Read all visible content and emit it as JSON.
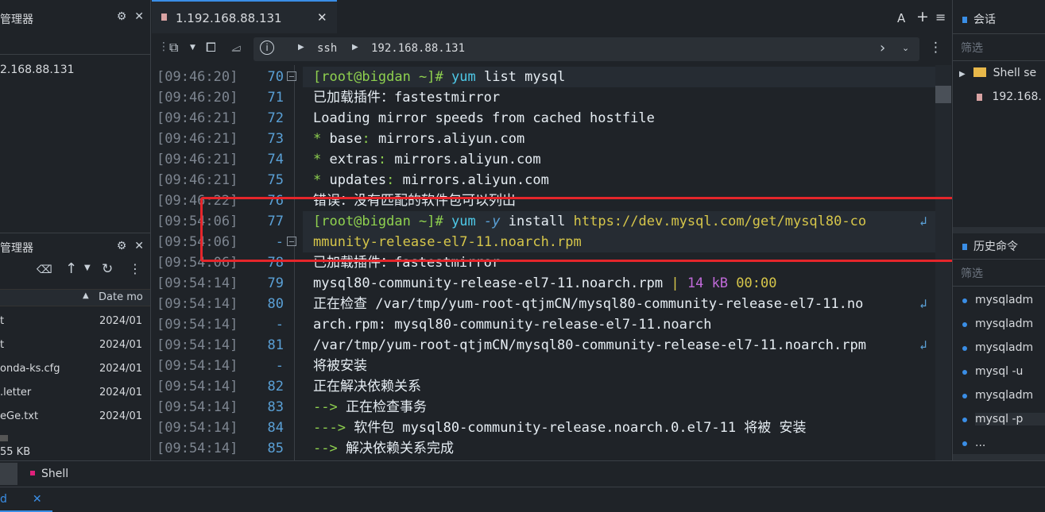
{
  "left": {
    "session_manager_title": "管理器",
    "session_host": "2.168.88.131",
    "file_manager_title": "管理器",
    "file_columns": [
      "Date mo"
    ],
    "files": [
      {
        "name": "t",
        "date": "2024/01"
      },
      {
        "name": "t",
        "date": "2024/01"
      },
      {
        "name": "onda-ks.cfg",
        "date": "2024/01"
      },
      {
        "name": ".letter",
        "date": "2024/01"
      },
      {
        "name": "eGe.txt",
        "date": "2024/01"
      }
    ],
    "file_status": "55 KB"
  },
  "tab": {
    "label": "1.192.168.88.131"
  },
  "tab_actions": {
    "font": "A",
    "add": "+",
    "menu": "≡"
  },
  "address": {
    "info": "i",
    "protocol": "ssh",
    "host": "192.168.88.131"
  },
  "terminal": {
    "lines": [
      {
        "ts": "[09:46:20]",
        "ln": "70",
        "fold": true,
        "type": "prompt",
        "prompt": "[root@bigdan ~]#",
        "cmd": "yum",
        "rest": " list mysql"
      },
      {
        "ts": "[09:46:20]",
        "ln": "71",
        "type": "text",
        "text": "已加载插件：fastestmirror"
      },
      {
        "ts": "[09:46:21]",
        "ln": "72",
        "type": "text",
        "text": "Loading mirror speeds from cached hostfile"
      },
      {
        "ts": "[09:46:21]",
        "ln": "73",
        "type": "kv",
        "key": "base",
        "val": "mirrors.aliyun.com"
      },
      {
        "ts": "[09:46:21]",
        "ln": "74",
        "type": "kv",
        "key": "extras",
        "val": "mirrors.aliyun.com"
      },
      {
        "ts": "[09:46:21]",
        "ln": "75",
        "type": "kv",
        "key": "updates",
        "val": "mirrors.aliyun.com"
      },
      {
        "ts": "[09:46:22]",
        "ln": "76",
        "type": "text",
        "text": "错误：没有匹配的软件包可以列出"
      },
      {
        "ts": "[09:54:06]",
        "ln": "77",
        "type": "install",
        "prompt": "[root@bigdan ~]#",
        "cmd": "yum",
        "flag": "-y",
        "word": "install",
        "url": "https://dev.mysql.com/get/mysql80-co",
        "wrap": true
      },
      {
        "ts": "[09:54:06]",
        "ln": "-",
        "fold": true,
        "type": "url",
        "url": "mmunity-release-el7-11.noarch.rpm"
      },
      {
        "ts": "[09:54:06]",
        "ln": "78",
        "type": "text",
        "text": "已加载插件：fastestmirror"
      },
      {
        "ts": "[09:54:14]",
        "ln": "79",
        "type": "progress",
        "file": "mysql80-community-release-el7-11.noarch.rpm",
        "sep": "|",
        "size": "14 kB",
        "time": "00:00"
      },
      {
        "ts": "[09:54:14]",
        "ln": "80",
        "type": "text",
        "text": "正在检查 /var/tmp/yum-root-qtjmCN/mysql80-community-release-el7-11.no",
        "wrap": true
      },
      {
        "ts": "[09:54:14]",
        "ln": "-",
        "type": "text",
        "text": "arch.rpm: mysql80-community-release-el7-11.noarch"
      },
      {
        "ts": "[09:54:14]",
        "ln": "81",
        "type": "text",
        "text": "/var/tmp/yum-root-qtjmCN/mysql80-community-release-el7-11.noarch.rpm",
        "wrap": true
      },
      {
        "ts": "[09:54:14]",
        "ln": "-",
        "type": "text",
        "text": " 将被安装"
      },
      {
        "ts": "[09:54:14]",
        "ln": "82",
        "type": "text",
        "text": "正在解决依赖关系"
      },
      {
        "ts": "[09:54:14]",
        "ln": "83",
        "type": "arrow",
        "arrow": "-->",
        "text": " 正在检查事务"
      },
      {
        "ts": "[09:54:14]",
        "ln": "84",
        "type": "arrow",
        "arrow": "--->",
        "text": " 软件包 mysql80-community-release.noarch.0.el7-11 将被 安装"
      },
      {
        "ts": "[09:54:14]",
        "ln": "85",
        "type": "arrow",
        "arrow": "-->",
        "text": " 解决依赖关系完成"
      }
    ]
  },
  "right": {
    "sessions_title": "会话",
    "filter_placeholder": "筛选",
    "tree_folder": "Shell se",
    "tree_host": "192.168.",
    "history_title": "历史命令",
    "history": [
      "mysqladm",
      "mysqladm",
      "mysqladm",
      "mysql -u",
      "mysqladm",
      "mysql -p",
      "..."
    ]
  },
  "bottom": {
    "tab_shell": "Shell",
    "tab_active": "d"
  },
  "colors": {
    "accent": "#3a8ee6",
    "annotation": "#e5262b",
    "prompt": "#8fd14f",
    "cmd": "#4ec9e8",
    "url": "#d6c64a"
  }
}
